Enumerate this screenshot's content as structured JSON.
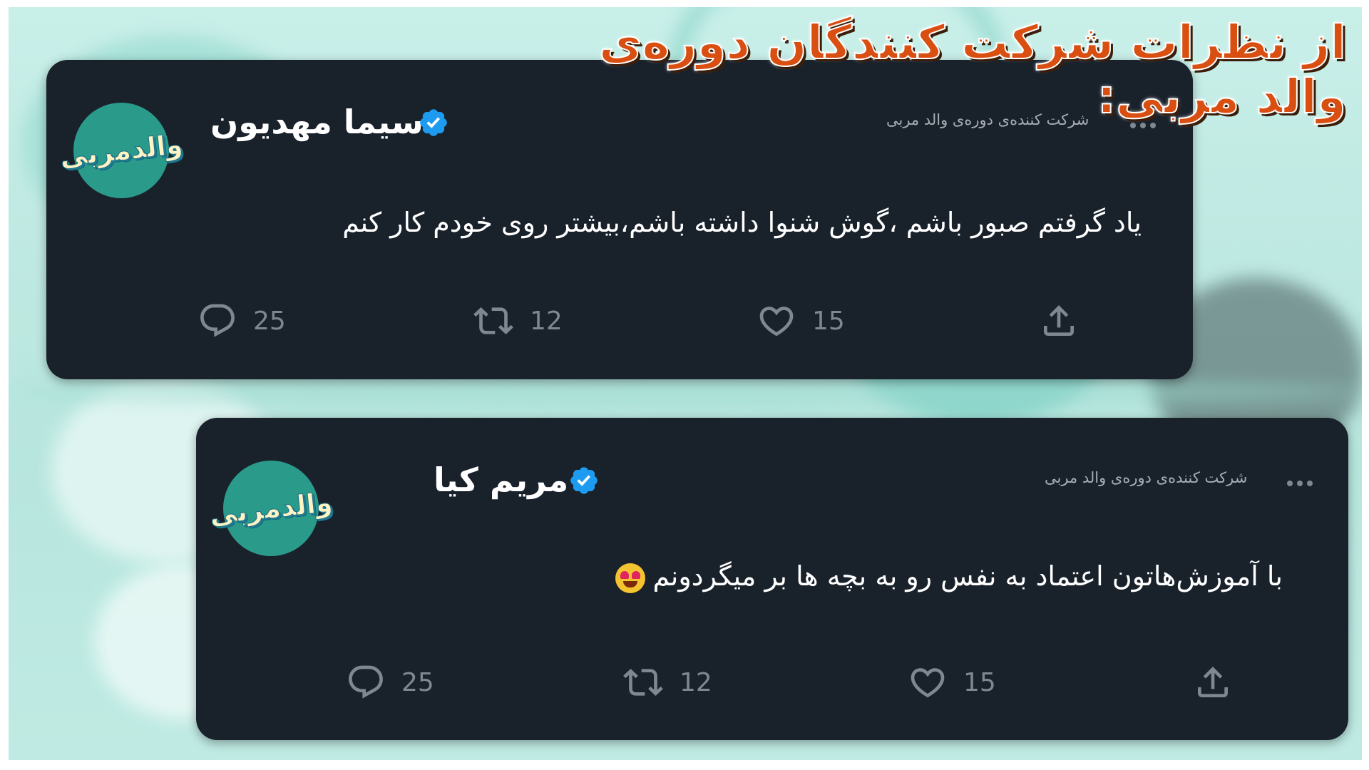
{
  "headline": "از نظرات شرکت کنندگان دوره‌ی والد مربی:",
  "posts": [
    {
      "avatar_label": "والدمربی",
      "author": "سیما مهدیون",
      "subtitle": "شرکت کننده‌ی دوره‌ی والد مربی",
      "text": "یاد گرفتم صبور باشم ،گوش شنوا داشته باشم،بیشتر روی خودم کار کنم",
      "replies": "25",
      "retweets": "12",
      "likes": "15"
    },
    {
      "avatar_label": "والدمربی",
      "author": "مریم کیا",
      "subtitle": "شرکت کننده‌ی دوره‌ی والد مربی",
      "text": "با آموزش‌هاتون اعتماد به نفس رو به بچه ها بر میگردونم",
      "replies": "25",
      "retweets": "12",
      "likes": "15"
    }
  ],
  "colors": {
    "card_bg": "#19212b",
    "verified": "#1d9bf0",
    "headline": "#d94f12",
    "icon_gray": "#7f8790"
  },
  "icons": [
    "verified-badge-icon",
    "more-dots-icon",
    "reply-icon",
    "retweet-icon",
    "like-icon",
    "share-icon",
    "heart-eyes-emoji-icon"
  ]
}
